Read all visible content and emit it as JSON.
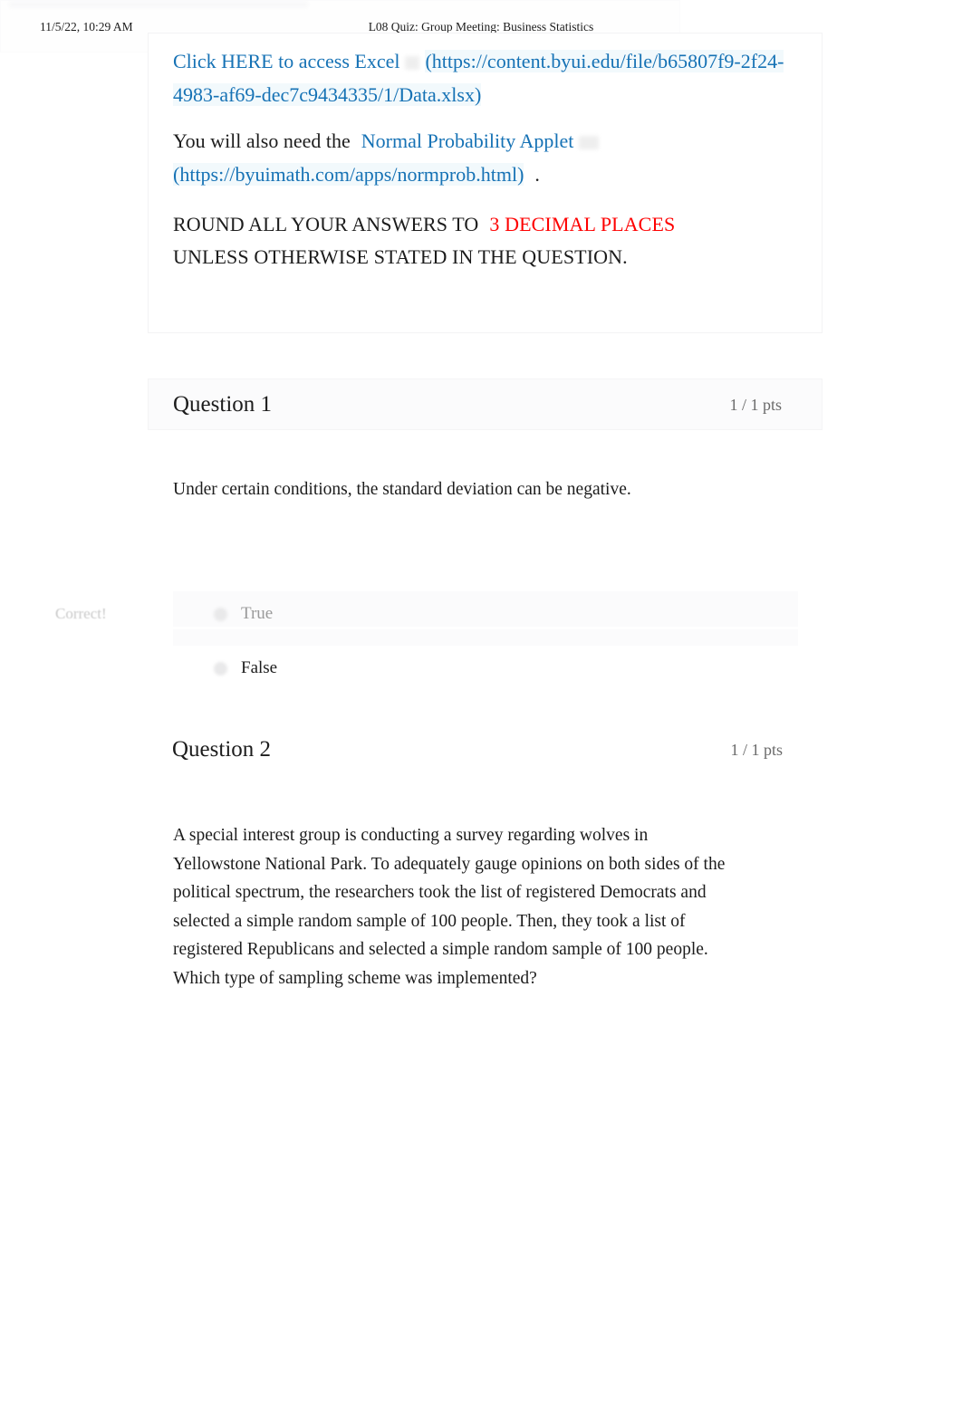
{
  "print_header": {
    "date": "11/5/22, 10:29 AM",
    "title": "L08 Quiz: Group Meeting: Business Statistics"
  },
  "colors": {
    "link": "#1672b5",
    "emphasis_red": "#fe0000",
    "muted_text": "#9a9a9a",
    "points_text": "#6a6a6a",
    "feedback_tag": "#c9c9c9",
    "card_border": "#f2f2f3",
    "band_background": "#fbfbfc"
  },
  "intro": {
    "excel_link_text": "Click HERE to access Excel",
    "excel_url_text": "(https://content.byui.edu/file/b65807f9-2f24-4983-af69-dec7c9434335/1/Data.xlsx)",
    "applet_lead_in": "You will also need the",
    "applet_link_text": "Normal Probability Applet",
    "applet_url_text": "(https://byuimath.com/apps/normprob.html)",
    "applet_trailing_period": ".",
    "rounding_prefix": "ROUND ALL YOUR ANSWERS TO",
    "rounding_emphasis": "3 DECIMAL PLACES",
    "rounding_suffix": "UNLESS OTHERWISE STATED IN THE QUESTION."
  },
  "questions": [
    {
      "title": "Question 1",
      "points": "1 / 1 pts",
      "prompt": "Under certain conditions, the standard deviation can be negative.",
      "feedback": "Correct!",
      "answers": [
        {
          "label": "True",
          "state": "muted"
        },
        {
          "label": "False",
          "state": "selected"
        }
      ]
    },
    {
      "title": "Question 2",
      "points": "1 / 1 pts",
      "prompt": "A special interest group is conducting a survey regarding wolves in Yellowstone National Park. To adequately gauge opinions on both sides of the political spectrum, the researchers took the list of registered Democrats and selected a simple random sample of 100 people. Then, they took a list of registered Republicans and selected a simple random sample of 100 people. Which type of sampling scheme was implemented?",
      "answers": []
    }
  ]
}
